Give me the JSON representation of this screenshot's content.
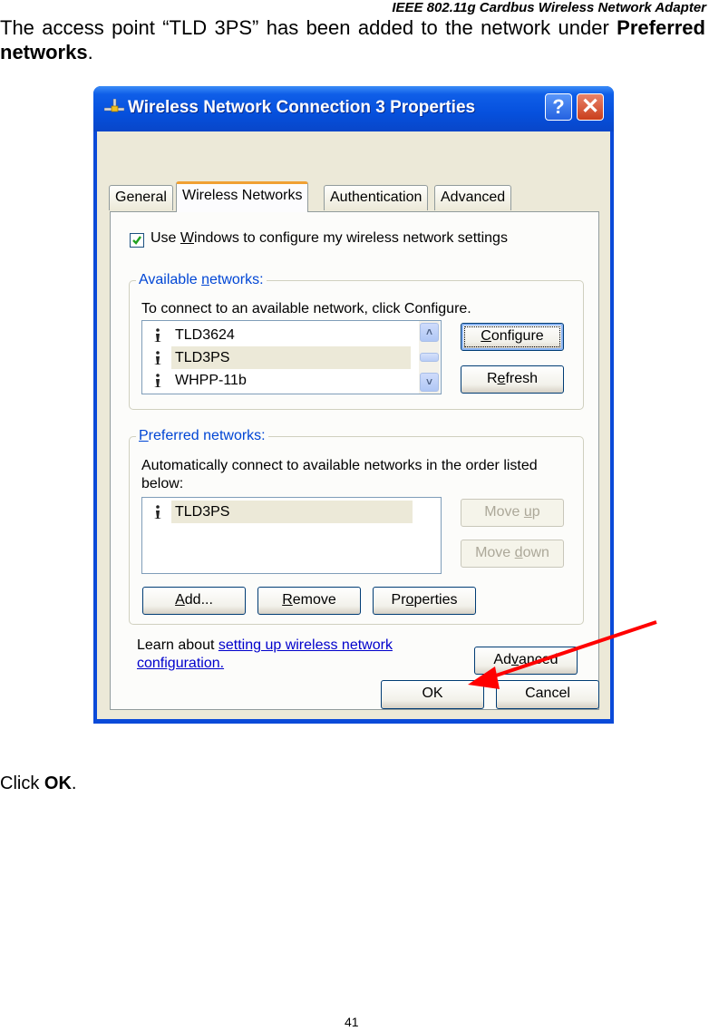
{
  "document": {
    "header": "IEEE 802.11g Cardbus Wireless Network Adapter",
    "intro_text": "The access point “TLD 3PS” has been added to the network under ",
    "intro_bold": "Preferred networks",
    "intro_end": ".",
    "instruction_prefix": "Click ",
    "instruction_bold": "OK",
    "instruction_end": ".",
    "page_number": "41"
  },
  "window": {
    "title": "Wireless Network Connection 3 Properties",
    "title_icon": "network-connection-icon",
    "help_button": "?",
    "close_button": "✕",
    "colors": {
      "titlebar": "#0650dd",
      "client": "#ece9d8",
      "group_label": "#0046d5",
      "link": "#0000cc",
      "annotation_arrow": "#ff0000"
    }
  },
  "tabs": [
    {
      "label": "General",
      "active": false
    },
    {
      "label": "Wireless Networks",
      "active": true
    },
    {
      "label": "Authentication",
      "active": false
    },
    {
      "label": "Advanced",
      "active": false
    }
  ],
  "use_windows": {
    "checked": true,
    "label_pre": "Use ",
    "label_u": "W",
    "label_post": "indows to configure my wireless network settings"
  },
  "available": {
    "label_pre": "Available ",
    "label_u": "n",
    "label_post": "etworks:",
    "description": "To connect to an available network, click Configure.",
    "networks": [
      {
        "name": "TLD3624",
        "selected": false
      },
      {
        "name": "TLD3PS",
        "selected": true
      },
      {
        "name": "WHPP-11b",
        "selected": false
      }
    ],
    "configure": {
      "u": "C",
      "rest": "onfigure"
    },
    "refresh": {
      "pre": "R",
      "u": "e",
      "rest": "fresh"
    }
  },
  "preferred": {
    "label_u": "P",
    "label_post": "referred networks:",
    "description_line1": "Automatically connect to available networks in the order listed",
    "description_line2": "below:",
    "networks": [
      {
        "name": "TLD3PS",
        "selected": true
      }
    ],
    "move_up": {
      "pre": "Move ",
      "u": "u",
      "rest": "p"
    },
    "move_down": {
      "pre": "Move ",
      "u": "d",
      "rest": "own"
    },
    "add": {
      "u": "A",
      "rest": "dd..."
    },
    "remove": {
      "u": "R",
      "rest": "emove"
    },
    "properties": {
      "pre": "Pr",
      "u": "o",
      "rest": "perties"
    }
  },
  "learn": {
    "prefix": "Learn about ",
    "link_line1": "setting up wireless network",
    "link_line2": "configuration."
  },
  "advanced_button": {
    "pre": "Ad",
    "u": "v",
    "rest": "anced"
  },
  "ok_button": "OK",
  "cancel_button": "Cancel"
}
